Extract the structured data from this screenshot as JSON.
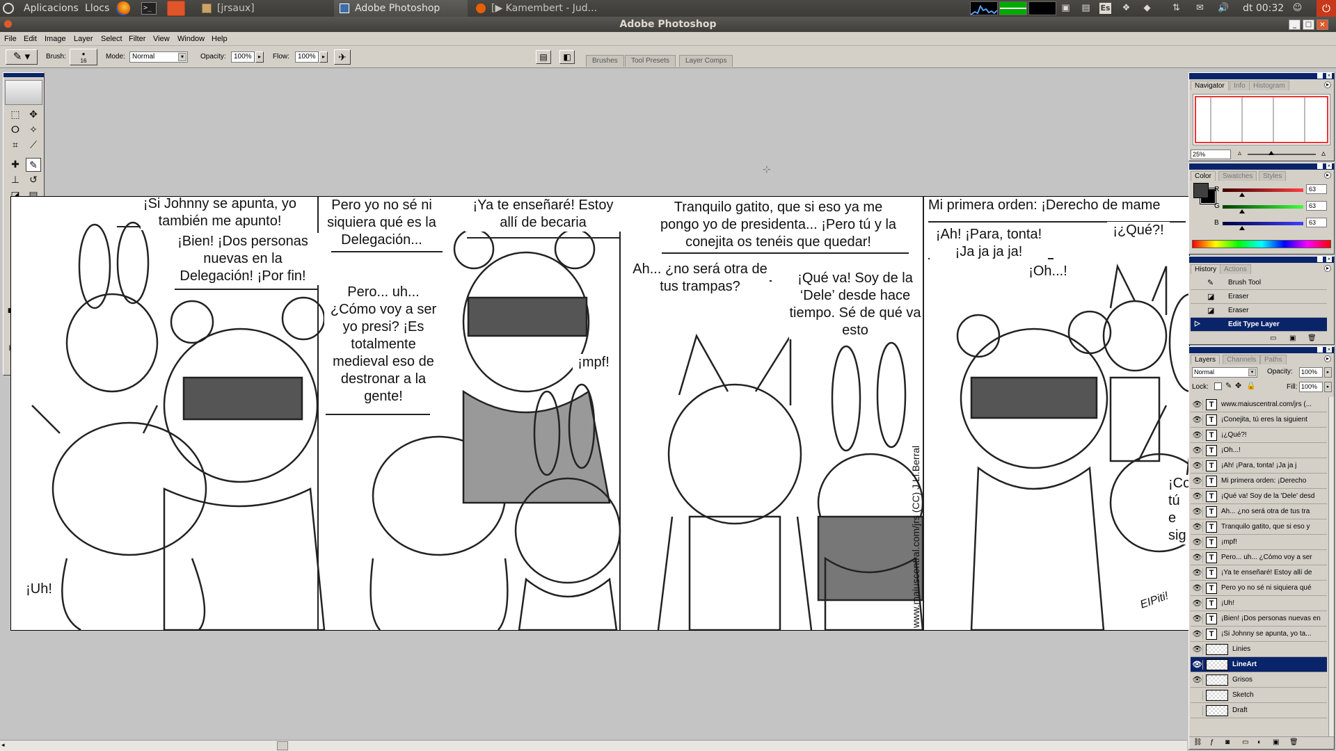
{
  "ubuntu_panel": {
    "menu_apps": "Aplicacions",
    "menu_places": "Llocs",
    "tasks": [
      {
        "label": "[jrsaux]"
      },
      {
        "label": "Adobe Photoshop"
      },
      {
        "label": "[▶ Kamembert - Jud..."
      }
    ],
    "input_method": "Es",
    "clock": "dt 00:32"
  },
  "window": {
    "title": "Adobe Photoshop"
  },
  "menubar": {
    "items": [
      "File",
      "Edit",
      "Image",
      "Layer",
      "Select",
      "Filter",
      "View",
      "Window",
      "Help"
    ]
  },
  "options_bar": {
    "brush_label": "Brush:",
    "brush_size": "16",
    "mode_label": "Mode:",
    "mode_value": "Normal",
    "opacity_label": "Opacity:",
    "opacity_value": "100%",
    "flow_label": "Flow:",
    "flow_value": "100%",
    "well_tabs": [
      "Brushes",
      "Tool Presets",
      "Layer Comps"
    ]
  },
  "comic": {
    "panel1": {
      "b1": "¡Si Johnny se apunta, yo también me apunto!",
      "b2": "¡Bien! ¡Dos personas nuevas en la Delegación! ¡Por fin!",
      "b3": "¡Uh!"
    },
    "panel2": {
      "b1": "Pero yo no sé ni siquiera qué es la Delegación...",
      "b2": "Pero... uh... ¿Cómo voy a ser yo presi? ¡Es totalmente medieval eso de destronar a la gente!",
      "b3": "¡Ya te enseñaré! Estoy allí de becaria",
      "b4": "¡mpf!"
    },
    "panel3": {
      "b1": "Tranquilo gatito, que si eso ya me pongo yo de presidenta... ¡Pero tú y la conejita os tenéis que quedar!",
      "b2": "Ah... ¿no será otra de tus trampas?",
      "b3": "¡Qué va! Soy de la ‘Dele’ desde hace tiempo. Sé de qué va esto",
      "credit": "www.maiuscentral.com/jrs (CC) J.Ll.Berral"
    },
    "panel4": {
      "b1": "Mi primera orden: ¡Derecho de mame",
      "b2": "¡Ah! ¡Para, tonta! ¡Ja ja ja ja!",
      "b3": "¡¿Qué?!",
      "b4": "¡Oh...!",
      "b5": "¡Co tú e sig",
      "signature": "EIPiti!"
    }
  },
  "navigator": {
    "tabs": [
      "Navigator",
      "Info",
      "Histogram"
    ],
    "zoom": "25%"
  },
  "color": {
    "tabs": [
      "Color",
      "Swatches",
      "Styles"
    ],
    "channels": [
      {
        "label": "R",
        "value": "63"
      },
      {
        "label": "G",
        "value": "63"
      },
      {
        "label": "B",
        "value": "63"
      }
    ],
    "fg_color": "#3f3f3f"
  },
  "history": {
    "tabs": [
      "History",
      "Actions"
    ],
    "items": [
      {
        "name": "Brush Tool",
        "selected": false
      },
      {
        "name": "Eraser",
        "selected": false
      },
      {
        "name": "Eraser",
        "selected": false
      },
      {
        "name": "Edit Type Layer",
        "selected": true
      }
    ]
  },
  "layers": {
    "tabs": [
      "Layers",
      "Channels",
      "Paths"
    ],
    "blend_mode": "Normal",
    "opacity_label": "Opacity:",
    "opacity_value": "100%",
    "lock_label": "Lock:",
    "fill_label": "Fill:",
    "fill_value": "100%",
    "items": [
      {
        "name": "www.maiuscentral.com/jrs (...",
        "type": "text",
        "visible": true,
        "selected": false
      },
      {
        "name": "¡Conejita, tú eres la siguient",
        "type": "text",
        "visible": true,
        "selected": false
      },
      {
        "name": "¡¿Qué?!",
        "type": "text",
        "visible": true,
        "selected": false
      },
      {
        "name": "¡Oh...!",
        "type": "text",
        "visible": true,
        "selected": false
      },
      {
        "name": "¡Ah! ¡Para, tonta! ¡Ja ja j",
        "type": "text",
        "visible": true,
        "selected": false
      },
      {
        "name": "Mi primera orden: ¡Derecho",
        "type": "text",
        "visible": true,
        "selected": false
      },
      {
        "name": "¡Qué va! Soy de la 'Dele' desd",
        "type": "text",
        "visible": true,
        "selected": false
      },
      {
        "name": "Ah... ¿no será otra de tus tra",
        "type": "text",
        "visible": true,
        "selected": false
      },
      {
        "name": "Tranquilo gatito, que si eso y",
        "type": "text",
        "visible": true,
        "selected": false
      },
      {
        "name": "¡mpf!",
        "type": "text",
        "visible": true,
        "selected": false
      },
      {
        "name": "Pero... uh... ¿Cómo voy a ser",
        "type": "text",
        "visible": true,
        "selected": false
      },
      {
        "name": "¡Ya te enseñaré! Estoy allí de",
        "type": "text",
        "visible": true,
        "selected": false
      },
      {
        "name": "Pero yo no sé ni siquiera qué",
        "type": "text",
        "visible": true,
        "selected": false
      },
      {
        "name": "¡Uh!",
        "type": "text",
        "visible": true,
        "selected": false
      },
      {
        "name": "¡Bien! ¡Dos personas nuevas en",
        "type": "text",
        "visible": true,
        "selected": false
      },
      {
        "name": "¡Si Johnny se apunta, yo ta...",
        "type": "text",
        "visible": true,
        "selected": false
      },
      {
        "name": "Linies",
        "type": "raster",
        "visible": true,
        "selected": false
      },
      {
        "name": "LineArt",
        "type": "raster",
        "visible": true,
        "selected": true
      },
      {
        "name": "Grisos",
        "type": "raster",
        "visible": true,
        "selected": false
      },
      {
        "name": "Sketch",
        "type": "raster",
        "visible": false,
        "selected": false
      },
      {
        "name": "Draft",
        "type": "raster",
        "visible": false,
        "selected": false
      }
    ]
  }
}
